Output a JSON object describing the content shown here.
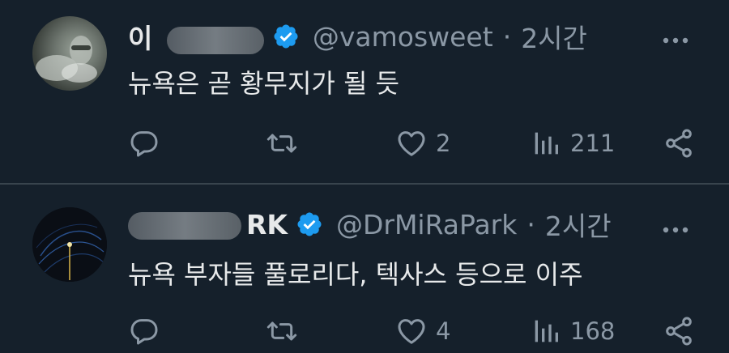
{
  "tweets": [
    {
      "name_visible": "이 ",
      "name_tail": "",
      "handle": "@vamosweet",
      "separator": "·",
      "time": "2시간",
      "text": "뉴욕은 곧 황무지가 될 듯",
      "likes": "2",
      "views": "211"
    },
    {
      "name_visible": "",
      "name_tail": "RK",
      "handle": "@DrMiRaPark",
      "separator": "·",
      "time": "2시간",
      "text": "뉴욕 부자들 풀로리다, 텍사스 등으로 이주",
      "likes": "4",
      "views": "168"
    }
  ],
  "icons": {
    "reply": "reply-icon",
    "retweet": "retweet-icon",
    "like": "heart-icon",
    "views": "views-icon",
    "share": "share-icon",
    "more": "more-icon",
    "verified": "verified-badge-icon"
  },
  "colors": {
    "background": "#15202b",
    "text": "#e7e9ea",
    "muted": "#8b98a5",
    "verified": "#1d9bf0",
    "divider": "#38444d"
  }
}
